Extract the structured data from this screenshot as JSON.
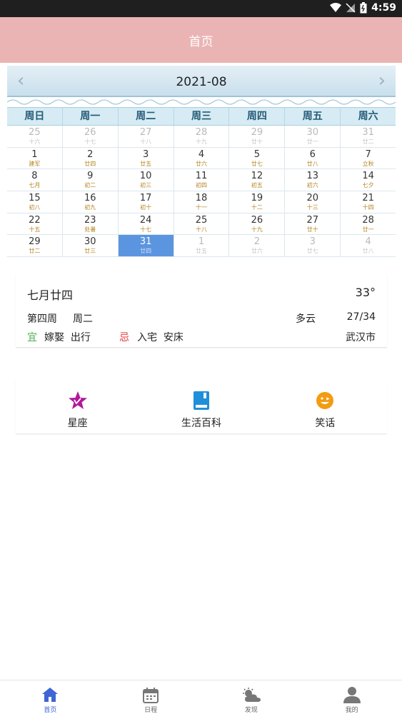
{
  "status_bar": {
    "time": "4:59"
  },
  "app_bar": {
    "title": "首页"
  },
  "calendar": {
    "month": "2021-08",
    "prev_icon": "chevron-left",
    "next_icon": "chevron-right",
    "weekdays": [
      "周日",
      "周一",
      "周二",
      "周三",
      "周四",
      "周五",
      "周六"
    ],
    "rows": [
      [
        {
          "d": "25",
          "l": "十六",
          "o": true
        },
        {
          "d": "26",
          "l": "十七",
          "o": true
        },
        {
          "d": "27",
          "l": "十八",
          "o": true
        },
        {
          "d": "28",
          "l": "十九",
          "o": true
        },
        {
          "d": "29",
          "l": "廿十",
          "o": true
        },
        {
          "d": "30",
          "l": "廿一",
          "o": true
        },
        {
          "d": "31",
          "l": "廿二",
          "o": true
        }
      ],
      [
        {
          "d": "1",
          "l": "建军"
        },
        {
          "d": "2",
          "l": "廿四"
        },
        {
          "d": "3",
          "l": "廿五"
        },
        {
          "d": "4",
          "l": "廿六"
        },
        {
          "d": "5",
          "l": "廿七"
        },
        {
          "d": "6",
          "l": "廿八"
        },
        {
          "d": "7",
          "l": "立秋"
        }
      ],
      [
        {
          "d": "8",
          "l": "七月"
        },
        {
          "d": "9",
          "l": "初二"
        },
        {
          "d": "10",
          "l": "初三"
        },
        {
          "d": "11",
          "l": "初四"
        },
        {
          "d": "12",
          "l": "初五"
        },
        {
          "d": "13",
          "l": "初六"
        },
        {
          "d": "14",
          "l": "七夕"
        }
      ],
      [
        {
          "d": "15",
          "l": "初八"
        },
        {
          "d": "16",
          "l": "初九"
        },
        {
          "d": "17",
          "l": "初十"
        },
        {
          "d": "18",
          "l": "十一"
        },
        {
          "d": "19",
          "l": "十二"
        },
        {
          "d": "20",
          "l": "十三"
        },
        {
          "d": "21",
          "l": "十四"
        }
      ],
      [
        {
          "d": "22",
          "l": "十五"
        },
        {
          "d": "23",
          "l": "处暑"
        },
        {
          "d": "24",
          "l": "十七"
        },
        {
          "d": "25",
          "l": "十八"
        },
        {
          "d": "26",
          "l": "十九"
        },
        {
          "d": "27",
          "l": "廿十"
        },
        {
          "d": "28",
          "l": "廿一"
        }
      ],
      [
        {
          "d": "29",
          "l": "廿二"
        },
        {
          "d": "30",
          "l": "廿三"
        },
        {
          "d": "31",
          "l": "廿四",
          "s": true
        },
        {
          "d": "1",
          "l": "廿五",
          "o": true
        },
        {
          "d": "2",
          "l": "廿六",
          "o": true
        },
        {
          "d": "3",
          "l": "廿七",
          "o": true
        },
        {
          "d": "4",
          "l": "廿八",
          "o": true
        }
      ]
    ]
  },
  "info": {
    "lunar": "七月廿四",
    "temp": "33°",
    "week": "第四周",
    "weekday": "周二",
    "weather": "多云",
    "range": "27/34",
    "yi_tag": "宜",
    "yi": "嫁娶  出行",
    "ji_tag": "忌",
    "ji": "入宅  安床",
    "city": "武汉市"
  },
  "shortcuts": [
    {
      "label": "星座",
      "icon": "star-icon"
    },
    {
      "label": "生活百科",
      "icon": "book-icon"
    },
    {
      "label": "笑话",
      "icon": "smiley-icon"
    }
  ],
  "bottom_nav": [
    {
      "label": "首页",
      "icon": "home-icon",
      "active": true
    },
    {
      "label": "日程",
      "icon": "calendar-icon"
    },
    {
      "label": "发现",
      "icon": "weather-icon"
    },
    {
      "label": "我的",
      "icon": "person-icon"
    }
  ],
  "colors": {
    "app_bar": "#ebb4b4",
    "selected_day": "#5b95e0",
    "lunar_text": "#b3841e",
    "yi": "#4caf50",
    "ji": "#e03a3a",
    "nav_active": "#3f65d6"
  }
}
